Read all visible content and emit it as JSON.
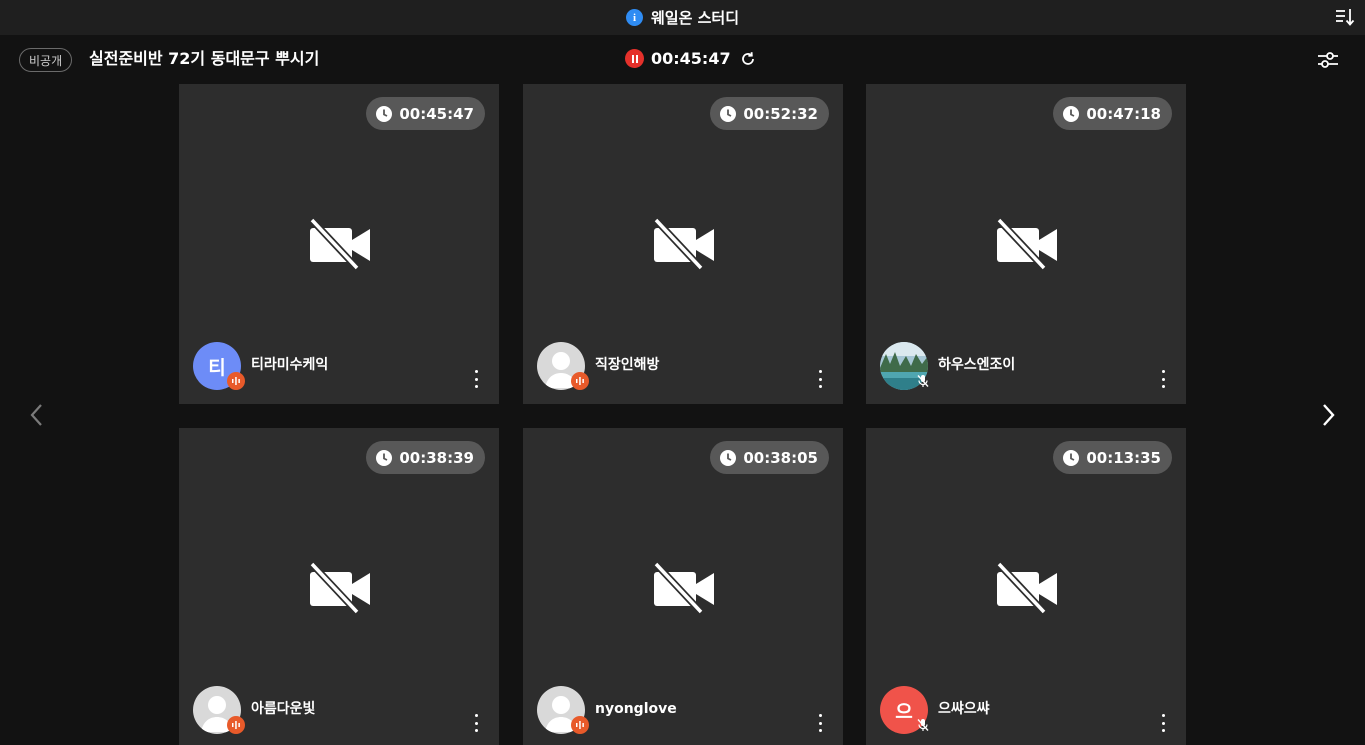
{
  "app": {
    "title": "웨일온 스터디"
  },
  "room": {
    "badge": "비공개",
    "title": "실전준비반 72기 동대문구 뿌시기",
    "timer": "00:45:47"
  },
  "colors": {
    "tile_bg": "#2d2d2d",
    "record": "#e5312b",
    "mic_active": "#e85a2a",
    "info": "#2f8cf3"
  },
  "participants": [
    {
      "name": "티라미수케익",
      "time": "00:45:47",
      "avatar": "letter",
      "initial": "티",
      "avatar_color": "#6d8cf7",
      "mic": "on"
    },
    {
      "name": "직장인해방",
      "time": "00:52:32",
      "avatar": "default",
      "initial": "",
      "avatar_color": "#d9d9d9",
      "mic": "on"
    },
    {
      "name": "하우스엔조이",
      "time": "00:47:18",
      "avatar": "photo",
      "initial": "",
      "avatar_color": "#5b8a6a",
      "mic": "off"
    },
    {
      "name": "아름다운빛",
      "time": "00:38:39",
      "avatar": "default",
      "initial": "",
      "avatar_color": "#d9d9d9",
      "mic": "on"
    },
    {
      "name": "nyonglove",
      "time": "00:38:05",
      "avatar": "default",
      "initial": "",
      "avatar_color": "#d9d9d9",
      "mic": "on"
    },
    {
      "name": "으쌰으쌰",
      "time": "00:13:35",
      "avatar": "letter",
      "initial": "으",
      "avatar_color": "#f0534a",
      "mic": "off"
    }
  ]
}
